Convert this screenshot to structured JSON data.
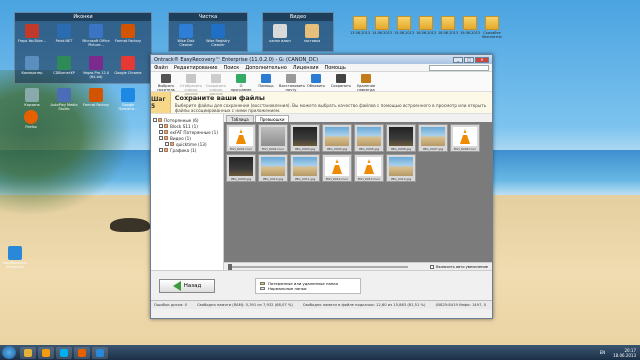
{
  "desktop": {
    "fences": [
      {
        "title": "Иконки",
        "icons": [
          {
            "label": "Fraps YouTube...",
            "color": "#c0392b"
          },
          {
            "label": "Paint.NET",
            "color": "#2b6cb0"
          },
          {
            "label": "Microsoft Office Picture...",
            "color": "#3a75c4"
          },
          {
            "label": "Format Factory",
            "color": "#d35400"
          },
          {
            "label": "Компьютер",
            "color": "#5a8fbf"
          },
          {
            "label": "CDBurnerXP",
            "color": "#2e8b57"
          },
          {
            "label": "Vegas Pro 12.0 (64-bit)",
            "color": "#7b2b8e"
          },
          {
            "label": "Google Chrome",
            "color": "#e53935"
          },
          {
            "label": "Корзина",
            "color": "#8aa"
          },
          {
            "label": "AutoPlay Media Studio",
            "color": "#4b6cb7"
          },
          {
            "label": "Format Factory",
            "color": "#d35400"
          },
          {
            "label": "Google Планета...",
            "color": "#1e88e5"
          }
        ]
      },
      {
        "title": "Чистка",
        "icons": [
          {
            "label": "Wise Disk Cleaner",
            "color": "#2e7dd7"
          },
          {
            "label": "Wise Registry Cleaner",
            "color": "#1f6fc4"
          }
        ]
      },
      {
        "title": "Видео",
        "icons": [
          {
            "label": "канал влюп",
            "color": "#d9d9d9"
          },
          {
            "label": "заставка",
            "color": "#e6c07b"
          }
        ]
      }
    ],
    "folders": [
      {
        "label": "13.06.2013"
      },
      {
        "label": "14.06.2013"
      },
      {
        "label": "15.06.2013"
      },
      {
        "label": "16.06.2013"
      },
      {
        "label": "18.06.2013"
      },
      {
        "label": "19.06.2013"
      },
      {
        "label": "Скачайте бесплатно"
      }
    ],
    "left_icons": [
      {
        "label": "Firefox",
        "color": "#e66000"
      },
      {
        "label": "EasyRecovery Enterprise",
        "color": "#2a88d8"
      }
    ]
  },
  "window": {
    "title": "Ontrack® EasyRecovery™ Enterprise (11.0.2.0) - G: (CANON_DC)",
    "menu": [
      "Файл",
      "Редактирование",
      "Поиск",
      "Дополнительно",
      "Лицензия",
      "Помощь"
    ],
    "toolbar": [
      {
        "label": "Выбрать носитель",
        "color": "#555",
        "disabled": false
      },
      {
        "label": "Отобразить список дисков",
        "color": "#777",
        "disabled": true
      },
      {
        "label": "Сохранить список дисков",
        "color": "#888",
        "disabled": true
      },
      {
        "label": "О программе",
        "color": "#3a6",
        "disabled": false
      },
      {
        "label": "Помощь",
        "color": "#2b7bd3",
        "disabled": false
      },
      {
        "label": "Восстановить почту",
        "color": "#999",
        "disabled": false
      },
      {
        "label": "Обновить",
        "color": "#2b7bd3",
        "disabled": false
      },
      {
        "label": "Сохранить",
        "color": "#444",
        "disabled": false
      },
      {
        "label": "Удаление навсегда",
        "color": "#c27a1a",
        "disabled": false
      }
    ],
    "step": {
      "number": "Шаг 5",
      "heading": "Сохраните ваши файлы",
      "desc": "Выберите файлы для сохранения (восстановления). Вы можете выбрать качество файлов с помощью встроенного в просмотр или открыть файлы ассоциированных с ними приложением."
    },
    "tree": [
      {
        "label": "Потерянные (6)",
        "indent": 0
      },
      {
        "label": "Block S11 (1)",
        "indent": 1
      },
      {
        "label": "exFAT Потерянные (1)",
        "indent": 1
      },
      {
        "label": "Видео (1)",
        "indent": 1
      },
      {
        "label": "quicktime (13)",
        "indent": 2
      },
      {
        "label": "Графика (1)",
        "indent": 1
      }
    ],
    "tabs": [
      "Таблица",
      "Превьюшки"
    ],
    "active_tab": 1,
    "thumbs": [
      {
        "label": "MVI_0001.mov",
        "kind": "vlc"
      },
      {
        "label": "MVI_0002.mov",
        "kind": "gray"
      },
      {
        "label": "IMG_0003.jpg",
        "kind": "dark"
      },
      {
        "label": "IMG_0004.jpg",
        "kind": "beach"
      },
      {
        "label": "IMG_0005.jpg",
        "kind": "beach"
      },
      {
        "label": "IMG_0006.jpg",
        "kind": "dark"
      },
      {
        "label": "IMG_0007.jpg",
        "kind": "beach"
      },
      {
        "label": "MVI_0008.mov",
        "kind": "vlc"
      },
      {
        "label": "IMG_0009.jpg",
        "kind": "dark"
      },
      {
        "label": "IMG_0010.jpg",
        "kind": "beach"
      },
      {
        "label": "IMG_0011.jpg",
        "kind": "beach"
      },
      {
        "label": "MVI_0012.mov",
        "kind": "vlc"
      },
      {
        "label": "MVI_0013.mov",
        "kind": "vlc"
      },
      {
        "label": "IMG_0014.jpg",
        "kind": "beach"
      }
    ],
    "zoom_checkbox": "Включить авто увеличение",
    "back_label": "Назад",
    "legend": [
      {
        "label": "Потерянные или удаленные папки",
        "color": "#e5c84a"
      },
      {
        "label": "Нормальные папки",
        "color": "#e6e6e6"
      }
    ],
    "status": [
      "Ошибки диска: 0",
      "Свободно памяти (RAM): 5,391 из 7,932 (68,07 %)",
      "Свободно памяти в файле подкачки: 12,60 из 15,863 (81,51 %)",
      "45825:8419 Инфо: 1497, 0"
    ]
  },
  "taskbar": {
    "apps": [
      {
        "name": "Explorer",
        "color": "#e2b13a"
      },
      {
        "name": "Media Player",
        "color": "#f39c12"
      },
      {
        "name": "Skype",
        "color": "#00aff0"
      },
      {
        "name": "Firefox",
        "color": "#e66000"
      },
      {
        "name": "EasyRecovery",
        "color": "#2a88d8"
      }
    ],
    "lang": "EN",
    "time": "20:17",
    "date": "18.06.2013"
  }
}
